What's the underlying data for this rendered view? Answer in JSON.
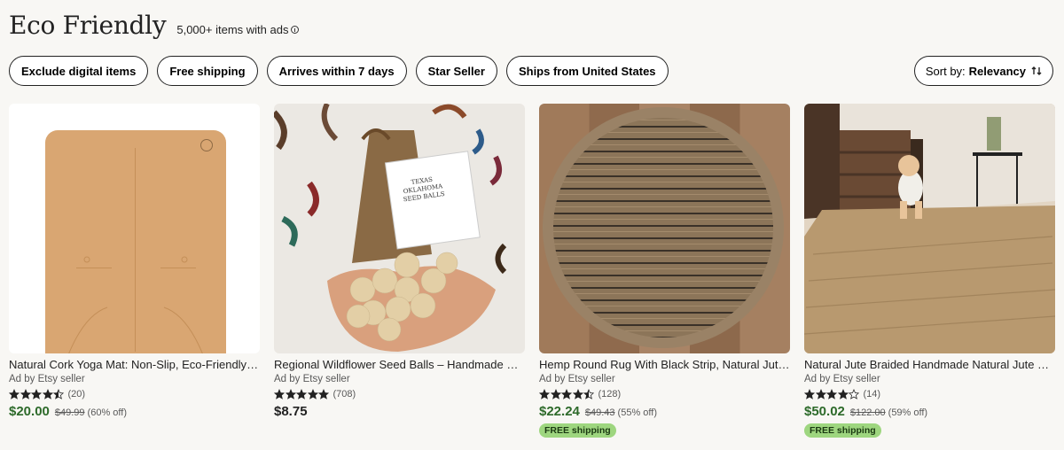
{
  "header": {
    "title": "Eco Friendly",
    "count": "5,000+ items with ads"
  },
  "filters": [
    "Exclude digital items",
    "Free shipping",
    "Arrives within 7 days",
    "Star Seller",
    "Ships from United States"
  ],
  "sort": {
    "prefix": "Sort by:",
    "value": "Relevancy"
  },
  "listings": [
    {
      "title": "Natural Cork Yoga Mat: Non-Slip, Eco-Friendly w...",
      "seller": "Ad by Etsy seller",
      "rating": 4.5,
      "reviews": "(20)",
      "price": "$20.00",
      "original_price": "$49.99",
      "discount": "(60% off)",
      "free_shipping": ""
    },
    {
      "title": "Regional Wildflower Seed Balls – Handmade Poll...",
      "seller": "Ad by Etsy seller",
      "rating": 5,
      "reviews": "(708)",
      "price": "$8.75",
      "original_price": "",
      "discount": "",
      "free_shipping": ""
    },
    {
      "title": "Hemp Round Rug With Black Strip, Natural Jute ...",
      "seller": "Ad by Etsy seller",
      "rating": 4.5,
      "reviews": "(128)",
      "price": "$22.24",
      "original_price": "$49.43",
      "discount": "(55% off)",
      "free_shipping": "FREE shipping"
    },
    {
      "title": "Natural Jute Braided Handmade Natural Jute Re...",
      "seller": "Ad by Etsy seller",
      "rating": 4,
      "reviews": "(14)",
      "price": "$50.02",
      "original_price": "$122.00",
      "discount": "(59% off)",
      "free_shipping": "FREE shipping"
    }
  ],
  "seed_label": {
    "line1": "TEXAS",
    "line2": "OKLAHOMA",
    "line3": "SEED BALLS"
  },
  "colors": {
    "sale_price": "#2d6a2a",
    "free_shipping_badge": "#9ed67f",
    "star": "#222222"
  }
}
